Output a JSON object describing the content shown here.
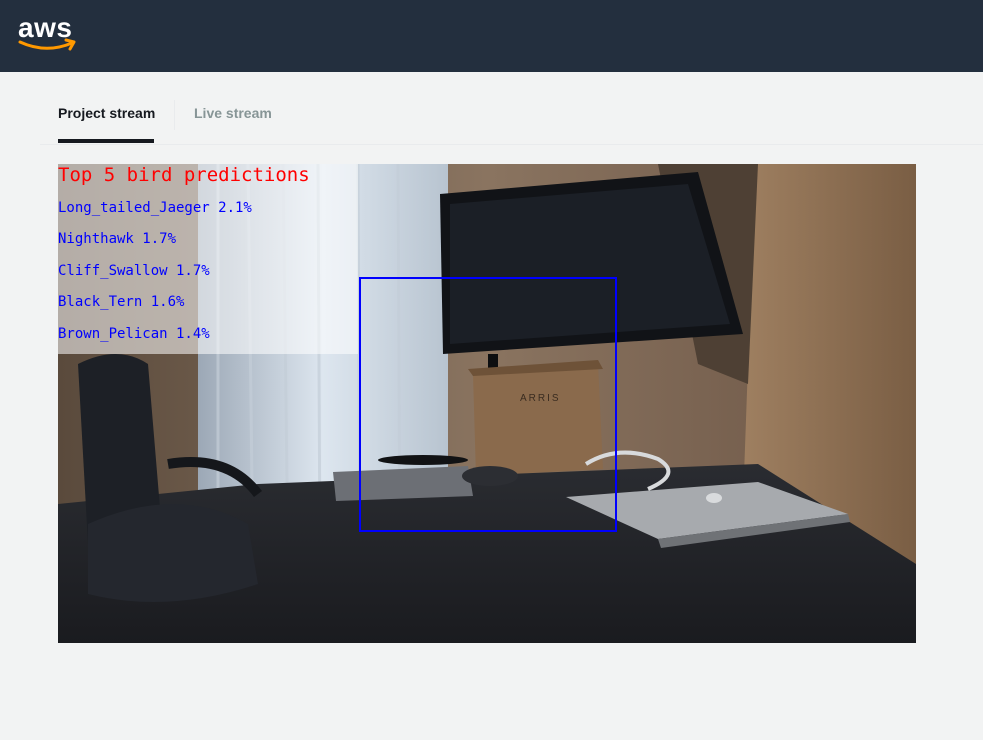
{
  "header": {
    "logo_text": "aws",
    "logo_smile_color": "#ff9900"
  },
  "tabs": [
    {
      "label": "Project stream",
      "active": true
    },
    {
      "label": "Live stream",
      "active": false
    }
  ],
  "stream": {
    "overlay": {
      "title": "Top 5 bird predictions",
      "title_color": "#ff0000",
      "prediction_color": "#0000ff",
      "predictions": [
        {
          "text": "Long_tailed_Jaeger 2.1%"
        },
        {
          "text": "Nighthawk 1.7%"
        },
        {
          "text": "Cliff_Swallow 1.7%"
        },
        {
          "text": "Black_Tern 1.6%"
        },
        {
          "text": "Brown_Pelican 1.4%"
        }
      ]
    },
    "scene_text": "ARRIS"
  }
}
